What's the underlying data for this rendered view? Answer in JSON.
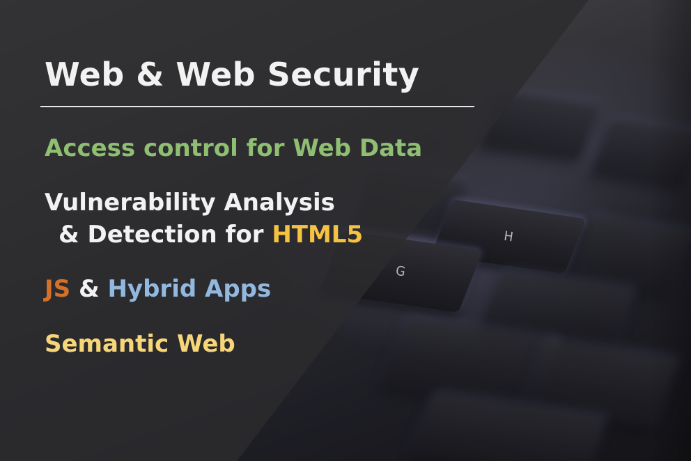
{
  "title": "Web & Web Security",
  "topics": {
    "access_control": "Access control for Web Data",
    "vuln_line1": "Vulnerability Analysis",
    "vuln_line2_prefix": "& Detection for ",
    "vuln_line2_highlight": "HTML5",
    "js_label": "JS",
    "js_amp": " & ",
    "hybrid_label": "Hybrid Apps",
    "semantic_web": "Semantic Web"
  },
  "keys": {
    "g_key": "G",
    "h_key": "H"
  },
  "colors": {
    "title": "#f2f2f2",
    "access_control": "#8fbf72",
    "html5": "#f5c242",
    "js": "#d2722a",
    "hybrid": "#93b8e0",
    "semantic_web": "#f7d67a",
    "overlay": "#2c2c2e"
  }
}
